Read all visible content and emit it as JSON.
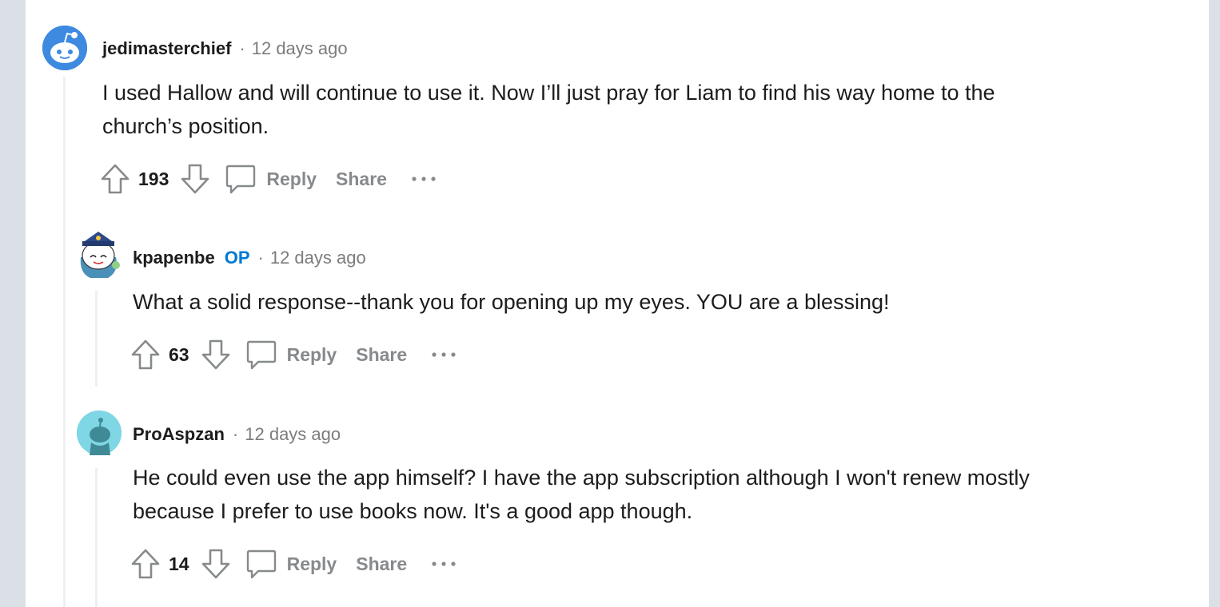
{
  "comments": [
    {
      "author": "jedimasterchief",
      "op_badge": "",
      "separator": "·",
      "time": "12 days ago",
      "lines": [
        "I used Hallow and will continue to use it. Now I’ll just pray for Liam to find his way home to the",
        "church’s position."
      ],
      "score": "193",
      "reply_label": "Reply",
      "share_label": "Share",
      "avatar_color": "#3d8ae0"
    },
    {
      "author": "kpapenbe",
      "op_badge": "OP",
      "separator": "·",
      "time": "12 days ago",
      "lines": [
        "What a solid response--thank you for opening up my eyes. YOU are a blessing!"
      ],
      "score": "63",
      "reply_label": "Reply",
      "share_label": "Share",
      "avatar_color": "#ffffff"
    },
    {
      "author": "ProAspzan",
      "op_badge": "",
      "separator": "·",
      "time": "12 days ago",
      "lines": [
        "He could even use the app himself? I have the app subscription although I won't renew mostly",
        "because I prefer to use books now. It's a good app though."
      ],
      "score": "14",
      "reply_label": "Reply",
      "share_label": "Share",
      "avatar_color": "#7fd6e4"
    }
  ],
  "colors": {
    "page_bg": "#dae0e6",
    "card_bg": "#ffffff",
    "muted": "#878a8c",
    "op_blue": "#0079d3",
    "thread_line": "#edeff1"
  },
  "icons": {
    "upvote": "arrow-up-outline-icon",
    "downvote": "arrow-down-outline-icon",
    "reply": "speech-bubble-icon",
    "more": "ellipsis-icon"
  }
}
